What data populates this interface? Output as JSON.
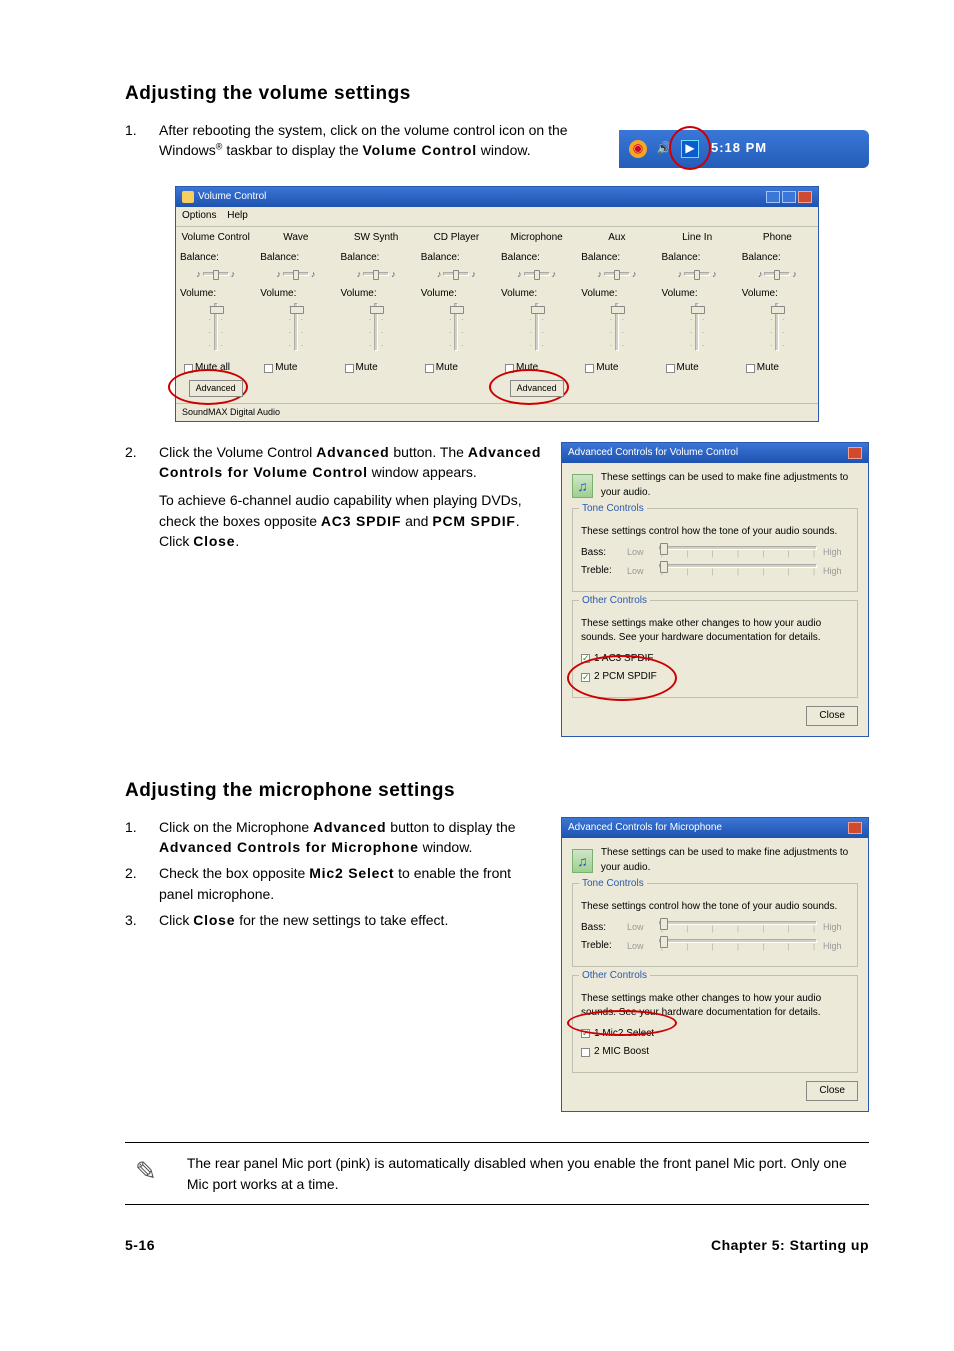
{
  "section1": {
    "heading": "Adjusting the volume settings",
    "step1_num": "1.",
    "step1_a": "After rebooting the system, click on the volume control icon on the Windows",
    "step1_reg": "®",
    "step1_b": " taskbar to display the ",
    "step1_c": "Volume Control",
    "step1_d": " window.",
    "step2_num": "2.",
    "step2_a": "Click the Volume Control ",
    "step2_b": "Advanced",
    "step2_c": " button. The ",
    "step2_d": "Advanced Controls for Volume Control",
    "step2_e": " window appears.",
    "step2_para2_a": "To achieve 6-channel audio capability when playing DVDs, check the boxes opposite ",
    "step2_para2_b": "AC3 SPDIF",
    "step2_para2_c": " and ",
    "step2_para2_d": "PCM SPDIF",
    "step2_para2_e": ". Click ",
    "step2_para2_f": "Close",
    "step2_para2_g": "."
  },
  "systray": {
    "time": "5:18 PM"
  },
  "vc": {
    "title": "Volume Control",
    "menu_options": "Options",
    "menu_help": "Help",
    "cols": [
      "Volume Control",
      "Wave",
      "SW Synth",
      "CD Player",
      "Microphone",
      "Aux",
      "Line In",
      "Phone"
    ],
    "balance": "Balance:",
    "volume": "Volume:",
    "mute_all": "Mute all",
    "mute": "Mute",
    "advanced": "Advanced",
    "status": "SoundMAX Digital Audio"
  },
  "adv1": {
    "title": "Advanced Controls for Volume Control",
    "head": "These settings can be used to make fine adjustments to your audio.",
    "tone_legend": "Tone Controls",
    "tone_desc": "These settings control how the tone of your audio sounds.",
    "bass": "Bass:",
    "treble": "Treble:",
    "low": "Low",
    "high": "High",
    "other_legend": "Other Controls",
    "other_desc": "These settings make other changes to how your audio sounds. See your hardware documentation for details.",
    "opt1": "1  AC3 SPDIF",
    "opt2": "2  PCM SPDIF",
    "close": "Close"
  },
  "section2": {
    "heading": "Adjusting the microphone settings",
    "s1n": "1.",
    "s1a": "Click on the Microphone ",
    "s1b": "Advanced",
    "s1c": " button to display the ",
    "s1d": "Advanced Controls for Microphone",
    "s1e": " window.",
    "s2n": "2.",
    "s2a": "Check the box opposite ",
    "s2b": "Mic2 Select",
    "s2c": " to enable the front panel microphone.",
    "s3n": "3.",
    "s3a": "Click ",
    "s3b": "Close",
    "s3c": " for the new settings to take effect."
  },
  "adv2": {
    "title": "Advanced Controls for Microphone",
    "head": "These settings can be used to make fine adjustments to your audio.",
    "tone_legend": "Tone Controls",
    "tone_desc": "These settings control how the tone of your audio sounds.",
    "bass": "Bass:",
    "treble": "Treble:",
    "low": "Low",
    "high": "High",
    "other_legend": "Other Controls",
    "other_desc": "These settings make other changes to how your audio sounds. See your hardware documentation for details.",
    "opt1": "1  Mic2 Select",
    "opt2": "2  MIC Boost",
    "close": "Close"
  },
  "note": {
    "text": "The rear panel Mic port (pink) is automatically disabled when you enable the front panel Mic port. Only one Mic port works at a time."
  },
  "footer": {
    "left": "5-16",
    "right": "Chapter 5: Starting up"
  }
}
